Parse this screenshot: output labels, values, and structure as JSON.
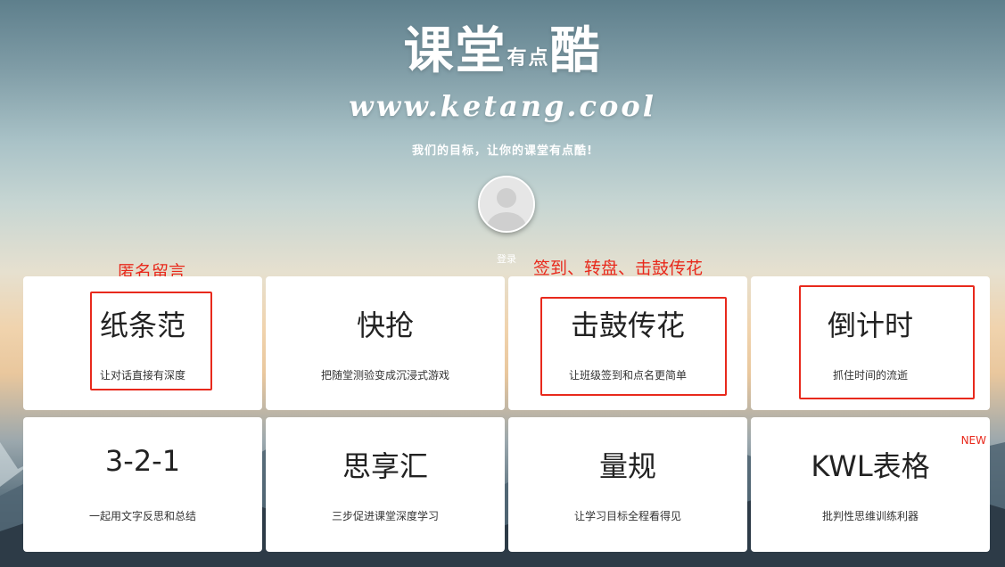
{
  "header": {
    "logo_main": "课堂",
    "logo_small": "有点",
    "logo_last": "酷",
    "url": "www.ketang.cool",
    "slogan": "我们的目标，让你的课堂有点酷!"
  },
  "user": {
    "login_label": "登录"
  },
  "annotations": {
    "left": "匿名留言",
    "right": "签到、转盘、击鼓传花"
  },
  "cards": [
    {
      "title": "纸条范",
      "desc": "让对话直接有深度"
    },
    {
      "title": "快抢",
      "desc": "把随堂测验变成沉浸式游戏"
    },
    {
      "title": "击鼓传花",
      "desc": "让班级签到和点名更简单"
    },
    {
      "title": "倒计时",
      "desc": "抓住时间的流逝"
    },
    {
      "title": "3-2-1",
      "desc": "一起用文字反思和总结"
    },
    {
      "title": "思享汇",
      "desc": "三步促进课堂深度学习"
    },
    {
      "title": "量规",
      "desc": "让学习目标全程看得见"
    },
    {
      "title": "KWL表格",
      "desc": "批判性思维训练利器",
      "badge": "NEW"
    }
  ],
  "colors": {
    "annotation": "#e8291c",
    "card_bg": "#ffffff"
  }
}
